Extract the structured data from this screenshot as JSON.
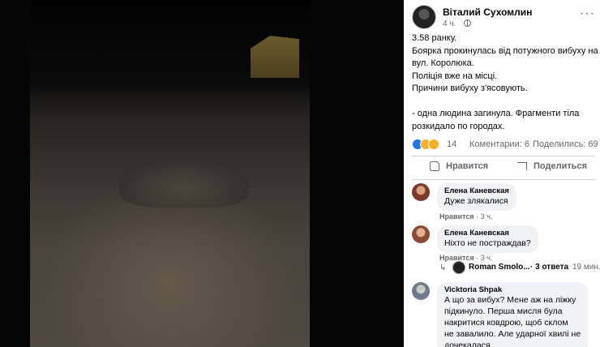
{
  "post": {
    "author": "Віталий Сухомлин",
    "time": "4 ч.",
    "lines": [
      "3.58 ранку.",
      "Боярка прокинулась від потужного вибуху на",
      "вул. Королюка.",
      "Поліція вже на місці.",
      "Причини вибуху з'ясовують.",
      "",
      "- одна людина загинула. Фрагменти тіла",
      "розкидало по городах."
    ],
    "reactions_count": "14",
    "comments_count": "Коментарии: 6",
    "shares_count": "Поделились: 69",
    "like_label": "Нравится",
    "share_label": "Поделиться"
  },
  "comments": [
    {
      "author": "Елена Каневская",
      "text": [
        "Дуже злякалися"
      ],
      "like_label": "Нравится",
      "time": "3 ч."
    },
    {
      "author": "Елена Каневская",
      "text": [
        "Ніхто не постраждав?"
      ],
      "like_label": "Нравится",
      "time": "3 ч."
    },
    {
      "author": "Vicktoria Shpak",
      "text": [
        "А що за вибух? Мене аж на ліжку",
        "підкинуло. Перша мисля була",
        "накритися ковдрою, щоб склом",
        "не завалило. Але ударної хвилі не",
        "дочекалася"
      ],
      "like_label": "",
      "time": ""
    }
  ],
  "reply_thread": {
    "name": "Roman Smolo...",
    "count": "· 3 ответа",
    "time": "19 мин."
  },
  "colors": {
    "link": "#1877f2",
    "secondary_text": "#65676b",
    "bubble": "#f0f2f5"
  }
}
